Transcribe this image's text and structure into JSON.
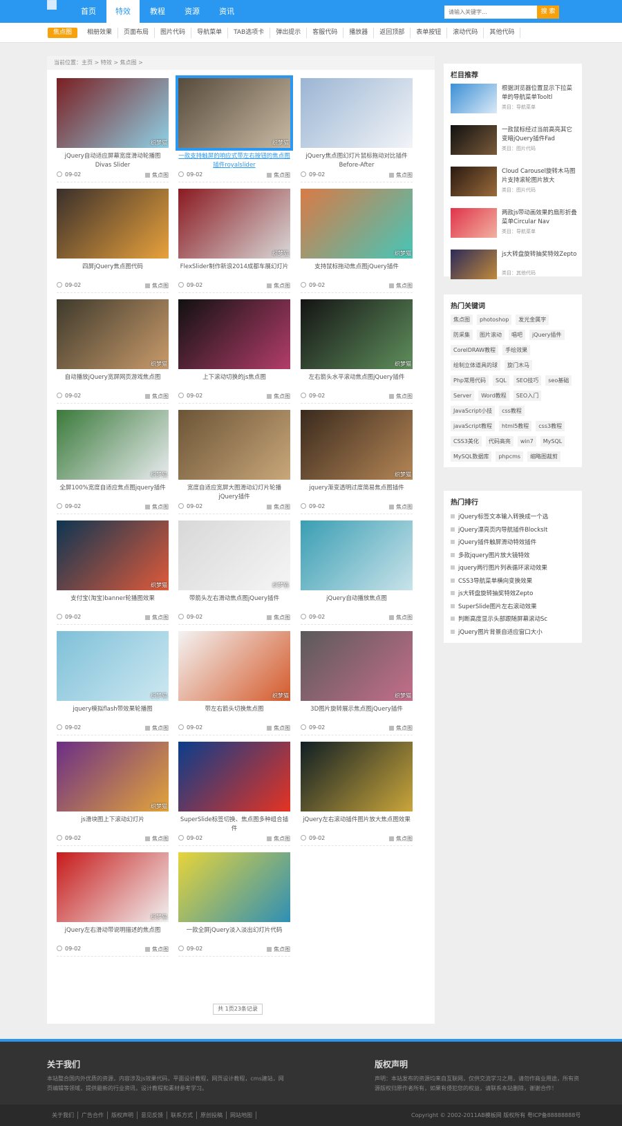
{
  "nav": {
    "items": [
      "首页",
      "特效",
      "教程",
      "资源",
      "资讯"
    ],
    "active": 1,
    "search_placeholder": "请输入关键字...",
    "search_button": "搜 索"
  },
  "subnav": {
    "items": [
      "焦点图",
      "相册效果",
      "页面布局",
      "图片代码",
      "导航菜单",
      "TAB选项卡",
      "弹出提示",
      "客服代码",
      "播放器",
      "返回顶部",
      "表单按钮",
      "滚动代码",
      "其他代码"
    ],
    "active": 0
  },
  "breadcrumb": "当前位置：主页 > 特效 > 焦点图 >",
  "cards": [
    {
      "title": "jQuery自动适应屏幕宽度滑动轮播图Divas Slider",
      "date": "09-02",
      "category": "焦点图",
      "watermark": "织梦猫",
      "c1": "#7a1f22",
      "c2": "#8fd1e6"
    },
    {
      "title": "一款支持触屏的响应式带左右按钮的焦点图插件royalslider",
      "date": "09-02",
      "category": "焦点图",
      "watermark": "织梦猫",
      "c1": "#574b3c",
      "c2": "#c8b9a2",
      "highlight": true
    },
    {
      "title": "jQuery焦点图幻灯片鼠标拖动对比插件Before-After",
      "date": "09-02",
      "category": "焦点图",
      "watermark": "",
      "c1": "#9bb5d4",
      "c2": "#f2f4f7"
    },
    {
      "title": "四屏jQuery焦点图代码",
      "date": "09-02",
      "category": "焦点图",
      "watermark": "",
      "c1": "#3a2f2b",
      "c2": "#e8a23c"
    },
    {
      "title": "FlexSlider制作新浪2014成都车展幻灯片",
      "date": "09-02",
      "category": "焦点图",
      "watermark": "织梦猫",
      "c1": "#8a1a20",
      "c2": "#d9d9d9"
    },
    {
      "title": "支持鼠标拖动焦点图jQuery插件",
      "date": "09-02",
      "category": "焦点图",
      "watermark": "织梦猫",
      "c1": "#d97a45",
      "c2": "#46c6b8"
    },
    {
      "title": "自动播放jQuery宽屏网页游戏焦点图",
      "date": "09-02",
      "category": "焦点图",
      "watermark": "织梦猫",
      "c1": "#3e3a2c",
      "c2": "#c99b6b"
    },
    {
      "title": "上下滚动切换的js焦点图",
      "date": "09-02",
      "category": "焦点图",
      "watermark": "",
      "c1": "#111111",
      "c2": "#b33d6a"
    },
    {
      "title": "左右箭头水平滚动焦点图jQuery插件",
      "date": "09-02",
      "category": "焦点图",
      "watermark": "织梦猫",
      "c1": "#141414",
      "c2": "#5f8f5c"
    },
    {
      "title": "全屏100%宽度自适应焦点图jquery插件",
      "date": "09-02",
      "category": "焦点图",
      "watermark": "织梦猫",
      "c1": "#3a7a3a",
      "c2": "#e9ecef"
    },
    {
      "title": "宽度自适应宽屏大图滑动幻灯片轮播jQuery插件",
      "date": "09-02",
      "category": "焦点图",
      "watermark": "",
      "c1": "#6b5436",
      "c2": "#c9a77a"
    },
    {
      "title": "jquery渐变透明过度简易焦点图插件",
      "date": "09-02",
      "category": "焦点图",
      "watermark": "织梦猫",
      "c1": "#3a2a1d",
      "c2": "#b58656"
    },
    {
      "title": "支付宝(淘宝)banner轮播图效果",
      "date": "09-02",
      "category": "焦点图",
      "watermark": "织梦猫",
      "c1": "#0d3552",
      "c2": "#e05a3a"
    },
    {
      "title": "带箭头左右滑动焦点图jQuery插件",
      "date": "09-02",
      "category": "焦点图",
      "watermark": "织梦猫",
      "c1": "#d8d8d8",
      "c2": "#f5f5f5"
    },
    {
      "title": "jQuery自动播放焦点图",
      "date": "09-02",
      "category": "焦点图",
      "watermark": "",
      "c1": "#3a9eb3",
      "c2": "#c9e3ea"
    },
    {
      "title": "jquery模拟flash带效果轮播图",
      "date": "09-02",
      "category": "焦点图",
      "watermark": "织梦猫",
      "c1": "#7ec0d8",
      "c2": "#cde8f1"
    },
    {
      "title": "带左右箭头切换焦点图",
      "date": "09-02",
      "category": "焦点图",
      "watermark": "织梦猫",
      "c1": "#f3f3f3",
      "c2": "#d45a2b"
    },
    {
      "title": "3D图片旋转展示焦点图jQuery插件",
      "date": "09-02",
      "category": "焦点图",
      "watermark": "织梦猫",
      "c1": "#5a5a5a",
      "c2": "#c46e8a"
    },
    {
      "title": "js滑块图上下滚动幻灯片",
      "date": "09-02",
      "category": "焦点图",
      "watermark": "织梦猫",
      "c1": "#6b2e86",
      "c2": "#e3a53a"
    },
    {
      "title": "SuperSlide标签切换、焦点图多种组合插件",
      "date": "09-02",
      "category": "焦点图",
      "watermark": "",
      "c1": "#0a3d8c",
      "c2": "#e63322"
    },
    {
      "title": "jQuery左右滚动插件图片放大焦点图效果",
      "date": "09-02",
      "category": "焦点图",
      "watermark": "",
      "c1": "#101e24",
      "c2": "#caa63b"
    },
    {
      "title": "jQuery左右滑动带说明描述的焦点图",
      "date": "09-02",
      "category": "焦点图",
      "watermark": "织梦猫",
      "c1": "#c71a1a",
      "c2": "#f1f1f1"
    },
    {
      "title": "一款全屏jQuery淡入淡出幻灯片代码",
      "date": "09-02",
      "category": "焦点图",
      "watermark": "",
      "c1": "#e7d43a",
      "c2": "#2f8fb5"
    }
  ],
  "pager": "共 1页23条记录",
  "sidebar": {
    "recommend_title": "栏目推荐",
    "recommend": [
      {
        "title": "根据浏览器位置显示下拉菜单的导航菜单Tooltl",
        "category": "类目：导航菜单",
        "c1": "#3b8fd6",
        "c2": "#dbe9f6"
      },
      {
        "title": "一款鼠标经过当前高亮其它变暗jQuery插件Fad",
        "category": "类目：图片代码",
        "c1": "#111111",
        "c2": "#7a5a3a"
      },
      {
        "title": "Cloud Carousel旋转木马图片支持滚轮图片放大",
        "category": "类目：图片代码",
        "c1": "#2a1a12",
        "c2": "#9a6b3a"
      },
      {
        "title": "两款js带动画效果的扇形折叠菜单Circular Nav",
        "category": "类目：导航菜单",
        "c1": "#e0344a",
        "c2": "#f2b1a0"
      },
      {
        "title": "js大转盘旋转抽奖特效Zepto",
        "category": "类目：其他代码",
        "c1": "#2d2a5a",
        "c2": "#c08a3a"
      }
    ],
    "tags_title": "热门关键词",
    "tags": [
      "焦点图",
      "photoshop",
      "发光金属字",
      "防采集",
      "图片滚动",
      "唱吧",
      "jQuery插件",
      "CorelDRAW教程",
      "手绘效果",
      "绘制立体道具的球",
      "旋门木马",
      "Php常用代码",
      "SQL",
      "SEO技巧",
      "seo基础",
      "Server",
      "Word教程",
      "SEO入门",
      "JavaScript小技",
      "css教程",
      "javaScript教程",
      "html5教程",
      "css3教程",
      "CSS3美化",
      "代码高亮",
      "win7",
      "MySQL",
      "MySQL数据库",
      "phpcms",
      "缩略图裁剪"
    ],
    "rank_title": "热门排行",
    "rank": [
      "jQuery标签文本输入转换成一个选",
      "jQuery漂亮页内导航插件BlocksIt",
      "jQuery插件触屏滑动特效插件",
      "多款jquery图片放大镜特效",
      "jquery两行图片列表循环滚动效果",
      "CSS3导航菜单横向变换效果",
      "js大转盘旋转抽奖特效Zepto",
      "SuperSlide图片左右滚动效果",
      "判断高度显示头部跟随屏幕滚动Sc",
      "jQuery图片背景自适应窗口大小"
    ]
  },
  "footer": {
    "about_title": "关于我们",
    "about_text": "本站整合国内外优质的资源，内容涉及js效果代码，平面设计教程，网页设计教程，cms建站，网页编辑等领域，提供最新的行业资讯，设计教程和素材参考学习。",
    "copyright_title": "版权声明",
    "copyright_text": "声明：本站发布的资源均来自互联网，仅供交流学习之用，请勿作商业用途，所有资源版权归原作者所有，如果有侵犯您的权益，请联系本站删除，谢谢合作！",
    "links": [
      "关于我们",
      "广告合作",
      "版权声明",
      "意见反馈",
      "联系方式",
      "原创投稿",
      "网站地图"
    ],
    "copyright": "Copyright © 2002-2011AB模板网 版权所有  粤ICP备88888888号"
  }
}
